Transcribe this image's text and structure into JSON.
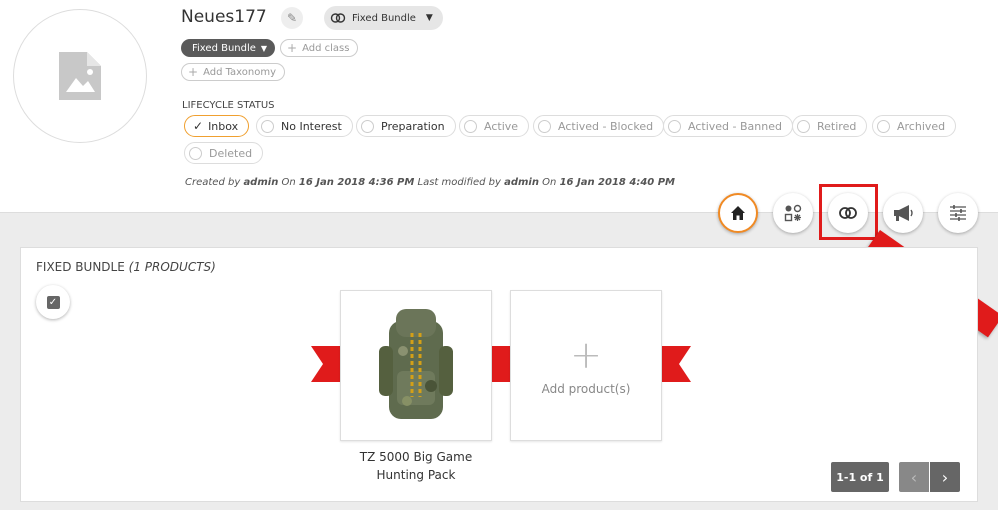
{
  "header": {
    "title": "Neues177",
    "type_selector": "Fixed Bundle",
    "class_tag": "Fixed Bundle",
    "add_class": "Add class",
    "add_taxonomy": "Add Taxonomy"
  },
  "lifecycle": {
    "label": "LIFECYCLE STATUS",
    "statuses": [
      {
        "label": "Inbox",
        "selected": true
      },
      {
        "label": "No Interest"
      },
      {
        "label": "Preparation"
      },
      {
        "label": "Active"
      },
      {
        "label": "Actived - Blocked"
      },
      {
        "label": "Actived - Banned"
      },
      {
        "label": "Retired"
      },
      {
        "label": "Archived"
      },
      {
        "label": "Deleted"
      }
    ]
  },
  "meta": {
    "created_prefix": "Created by",
    "created_by": "admin",
    "on1": "On",
    "created_on": "16 Jan 2018 4:36 PM",
    "modified_prefix": "Last modified by",
    "modified_by": "admin",
    "on2": "On",
    "modified_on": "16 Jan 2018 4:40 PM"
  },
  "nav_icons": [
    "home-icon",
    "attributes-icon",
    "bundle-rings-icon",
    "megaphone-icon",
    "filter-list-icon"
  ],
  "panel": {
    "title": "FIXED BUNDLE",
    "count": "(1 PRODUCTS)",
    "product_name": "TZ 5000 Big Game Hunting Pack",
    "add_label": "Add product(s)",
    "pager": "1-1 of 1"
  },
  "colors": {
    "accent_orange": "#f08a24",
    "ribbon_red": "#e01b1b",
    "highlight_red": "#e01b1b"
  }
}
